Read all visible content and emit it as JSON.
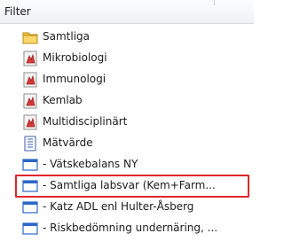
{
  "header": {
    "title": "Filter"
  },
  "items": [
    {
      "label": "Samtliga",
      "icon": "folder-icon"
    },
    {
      "label": "Mikrobiologi",
      "icon": "lab-report-icon"
    },
    {
      "label": "Immunologi",
      "icon": "lab-report-icon"
    },
    {
      "label": "Kemlab",
      "icon": "lab-report-icon"
    },
    {
      "label": "Multidisciplinärt",
      "icon": "lab-report-icon"
    },
    {
      "label": "Mätvärde",
      "icon": "measurement-icon"
    },
    {
      "label": "- Vätskebalans NY",
      "icon": "window-icon"
    },
    {
      "label": "- Samtliga labsvar (Kem+Farm...",
      "icon": "window-icon",
      "selected": true
    },
    {
      "label": "- Katz ADL enl Hulter-Åsberg",
      "icon": "window-icon"
    },
    {
      "label": "- Riskbedömning undernäring, ...",
      "icon": "window-icon"
    }
  ],
  "colors": {
    "highlight": "#e0262b",
    "folder": "#f3c14b",
    "report": "#c22d34",
    "window": "#2b66c7"
  }
}
